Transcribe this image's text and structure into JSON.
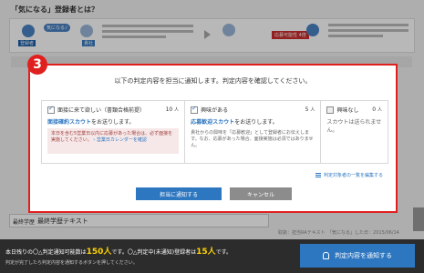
{
  "background": {
    "title": "「気になる」登録者とは？",
    "bubble_text": "気になる♪",
    "label_registrant": "登録者",
    "label_company": "貴社",
    "red_pill": "応募可能性 4倍",
    "field_label": "最終学歴",
    "field_value": "最終学歴テキスト",
    "right_text": "取扱：担当RAテキスト　「気になる」した日：2015/06/14",
    "page_tab": "ページ"
  },
  "step_number": "3",
  "modal": {
    "heading": "以下の判定内容を担当に通知します。判定内容を確認してください。",
    "columns": [
      {
        "title": "面接に来て欲しい（書類合格前提）",
        "count": "10",
        "unit": "人",
        "checked": true,
        "sub_em": "面接確約スカウト",
        "sub_rest": "をお送りします。",
        "note": "本日を含む5営業日以内に応募があった場合は、必ず面接を実施してください。",
        "note_link": "› 営業日カレンダーを確認"
      },
      {
        "title": "興味がある",
        "count": "5",
        "unit": "人",
        "checked": true,
        "sub_em": "応募歓迎スカウト",
        "sub_rest": "をお送りします。",
        "note": "貴社からの興味を「応募歓迎」として登録者にお伝えします。なお、応募があった場合、面接実施は必須ではありません。"
      },
      {
        "title": "興味なし",
        "count": "0",
        "unit": "人",
        "checked": false,
        "note": "スカウトは送られません。"
      }
    ],
    "edit_link": "判定対象者の一覧を編集する",
    "confirm_button": "担当に通知する",
    "cancel_button": "キャンセル"
  },
  "bottom_bar": {
    "line1_prefix": "本日残りの〇△判定通知可能数は",
    "notify_count": "150人",
    "line1_middle": "です。〇△判定中(未通知)登録者は",
    "pending_count": "15人",
    "line1_suffix": "です。",
    "line2": "判定が完了したら判定内容を通知するボタンを押してください。",
    "notify_button": "判定内容を通知する"
  },
  "colors": {
    "accent_blue": "#2d76c0",
    "step_red": "#e0201e",
    "bar_dark": "#2c2c2c",
    "highlight_yellow": "#ffd200"
  }
}
